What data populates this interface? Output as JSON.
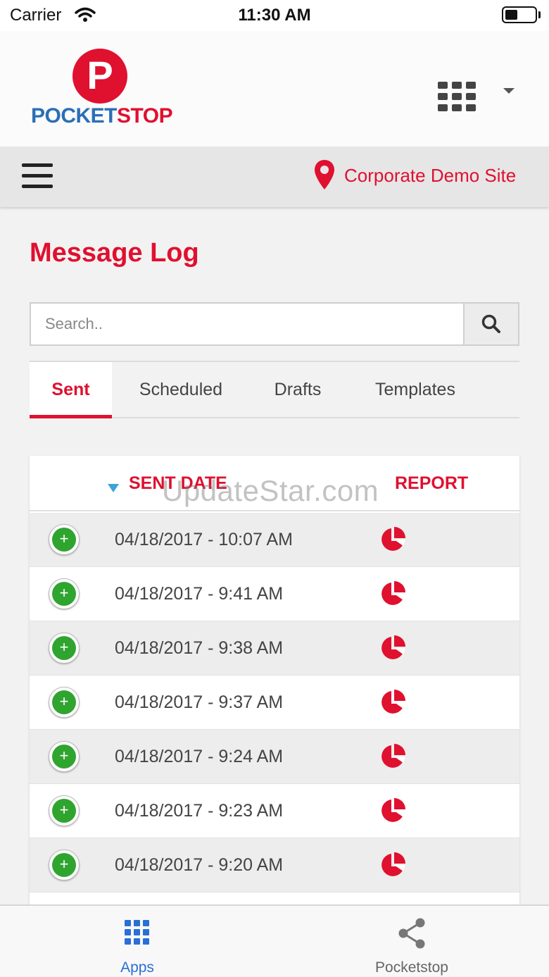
{
  "status_bar": {
    "carrier": "Carrier",
    "time": "11:30 AM"
  },
  "header": {
    "logo_letter": "P",
    "logo_pocket": "POCKET",
    "logo_stop": "STOP",
    "brand_red": "#e0102f",
    "brand_blue": "#2a6fb6"
  },
  "nav": {
    "site": "Corporate Demo Site"
  },
  "page": {
    "title": "Message Log"
  },
  "search": {
    "placeholder": "Search.."
  },
  "tabs": [
    {
      "label": "Sent",
      "active": true
    },
    {
      "label": "Scheduled",
      "active": false
    },
    {
      "label": "Drafts",
      "active": false
    },
    {
      "label": "Templates",
      "active": false
    }
  ],
  "table": {
    "headers": {
      "sent_date": "SENT DATE",
      "report": "REPORT"
    },
    "rows": [
      {
        "sent_date": "04/18/2017 - 10:07 AM"
      },
      {
        "sent_date": "04/18/2017 - 9:41 AM"
      },
      {
        "sent_date": "04/18/2017 - 9:38 AM"
      },
      {
        "sent_date": "04/18/2017 - 9:37 AM"
      },
      {
        "sent_date": "04/18/2017 - 9:24 AM"
      },
      {
        "sent_date": "04/18/2017 - 9:23 AM"
      },
      {
        "sent_date": "04/18/2017 - 9:20 AM"
      }
    ]
  },
  "watermark": "UpdateStar.com",
  "bottom_tabs": {
    "apps": "Apps",
    "pocketstop": "Pocketstop"
  }
}
